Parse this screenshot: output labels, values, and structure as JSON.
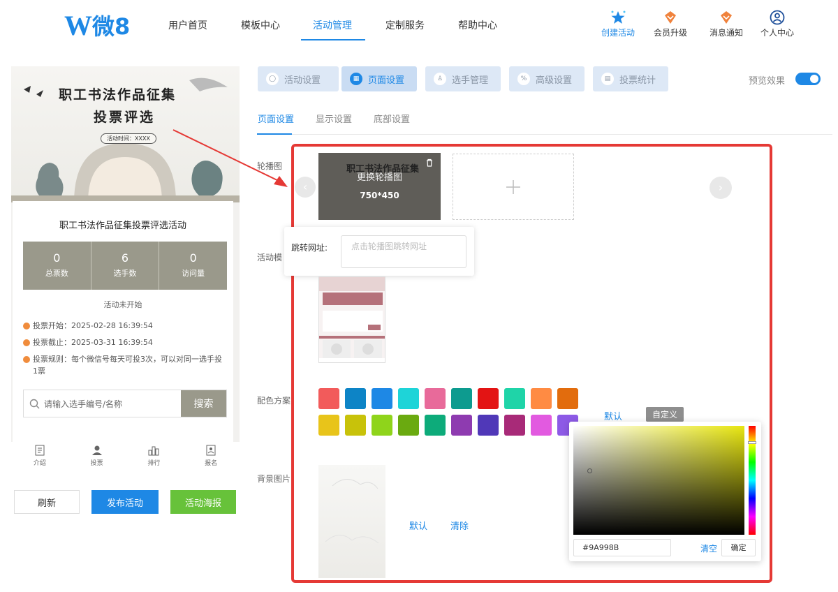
{
  "header": {
    "logo_w": "W",
    "logo_text": "微8",
    "nav": [
      "用户首页",
      "模板中心",
      "活动管理",
      "定制服务",
      "帮助中心"
    ],
    "right": [
      {
        "label": "创建活动",
        "icon": "star-icon"
      },
      {
        "label": "会员升级",
        "icon": "diamond-icon"
      },
      {
        "label": "消息通知",
        "icon": "diamond-icon"
      },
      {
        "label": "个人中心",
        "icon": "user-icon"
      }
    ]
  },
  "preview": {
    "banner_title_1": "职工书法作品征集",
    "banner_title_2": "投票评选",
    "banner_date": "活动时间：XXXX",
    "activity_title": "职工书法作品征集投票评选活动",
    "stats": [
      {
        "value": "0",
        "label": "总票数"
      },
      {
        "value": "6",
        "label": "选手数"
      },
      {
        "value": "0",
        "label": "访问量"
      }
    ],
    "status": "活动未开始",
    "rules": [
      "投票开始：2025-02-28 16:39:54",
      "投票截止：2025-03-31 16:39:54",
      "投票规则：每个微信号每天可投3次，可以对同一选手投1票"
    ],
    "search_placeholder": "请输入选手编号/名称",
    "search_button": "搜索",
    "tabbar": [
      "介绍",
      "投票",
      "排行",
      "报名"
    ]
  },
  "actions": {
    "refresh": "刷新",
    "publish": "发布活动",
    "poster": "活动海报"
  },
  "settings_tabs": [
    "活动设置",
    "页面设置",
    "选手管理",
    "高级设置",
    "投票统计"
  ],
  "preview_toggle_label": "预览效果",
  "sub_tabs": [
    "页面设置",
    "显示设置",
    "底部设置"
  ],
  "form": {
    "carousel_label": "轮播图",
    "carousel_overlay": "更换轮播图",
    "carousel_size": "750*450",
    "carousel_thumb_title": "职工书法作品征集",
    "jump_url_label": "跳转网址:",
    "jump_url_placeholder": "点击轮播图跳转网址",
    "template_label": "活动模",
    "color_label": "配色方案",
    "bg_label": "背景图片",
    "default": "默认",
    "custom": "自定义",
    "clear": "清除"
  },
  "colors": {
    "accent": "#1e88e5",
    "theme": "#9a998b",
    "swatches_row1": [
      "#f25b5b",
      "#0d84c6",
      "#1e88e5",
      "#1ed4d8",
      "#e86a9a",
      "#0d9b8f",
      "#e31414",
      "#1fd4a8",
      "#ff8b43",
      "#e26c0d"
    ],
    "swatches_row2": [
      "#e8c41a",
      "#c8c20a",
      "#8fd41b",
      "#6aaa10",
      "#0dab7a",
      "#8e3bb0",
      "#5038b8",
      "#a82a78",
      "#e25ae0",
      "#8d5ae6"
    ]
  },
  "picker": {
    "hex_value": "#9A998B",
    "clear": "清空",
    "confirm": "确定"
  }
}
